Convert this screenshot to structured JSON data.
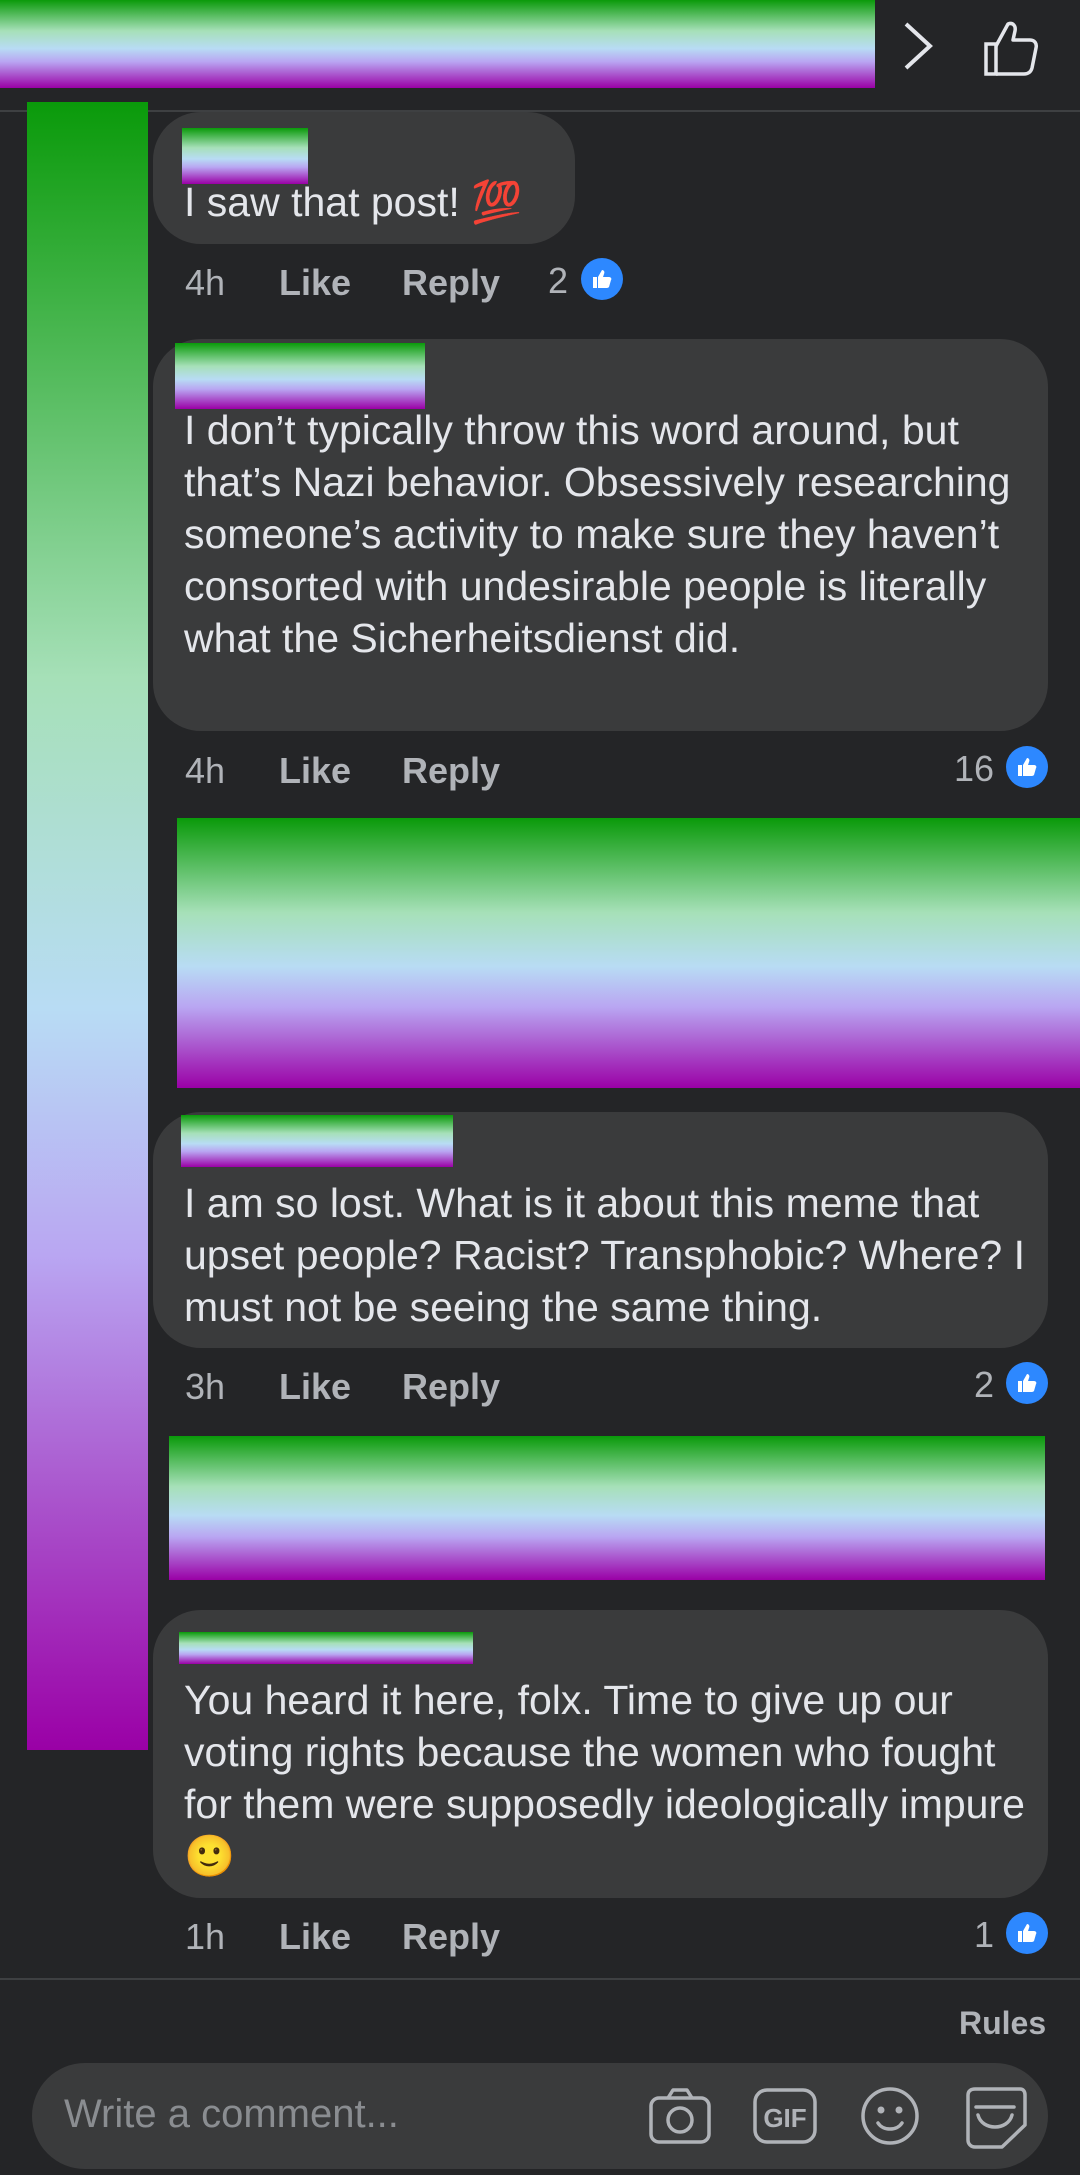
{
  "header": {
    "chevron_icon": "chevron-right-icon",
    "like_icon": "thumbs-up-outline-icon"
  },
  "comments": [
    {
      "text": "I saw that post! 💯",
      "time": "4h",
      "like": "Like",
      "reply": "Reply",
      "reactions": "2"
    },
    {
      "text": "I don’t typically throw this word around, but that’s Nazi behavior. Obsessively researching someone’s activity to make sure they haven’t consorted with undesirable people is literally what the Sicherheitsdienst did.",
      "time": "4h",
      "like": "Like",
      "reply": "Reply",
      "reactions": "16"
    },
    {
      "text": "I am so lost. What is it about this meme that upset people? Racist? Transphobic? Where? I must not be seeing the same thing.",
      "time": "3h",
      "like": "Like",
      "reply": "Reply",
      "reactions": "2"
    },
    {
      "text": "You heard it here, folx. Time to give up our voting rights because the women who fought for them were supposedly ideologically impure 🙂",
      "time": "1h",
      "like": "Like",
      "reply": "Reply",
      "reactions": "1"
    }
  ],
  "footer": {
    "rules": "Rules",
    "placeholder": "Write a comment...",
    "icons": [
      "camera-icon",
      "gif-icon",
      "emoji-icon",
      "sticker-icon"
    ],
    "gif_label": "GIF"
  },
  "colors": {
    "background": "#242527",
    "bubble": "#3a3b3c",
    "text": "#e4e6eb",
    "muted": "#b0b3b8",
    "reaction": "#2d88ff"
  }
}
